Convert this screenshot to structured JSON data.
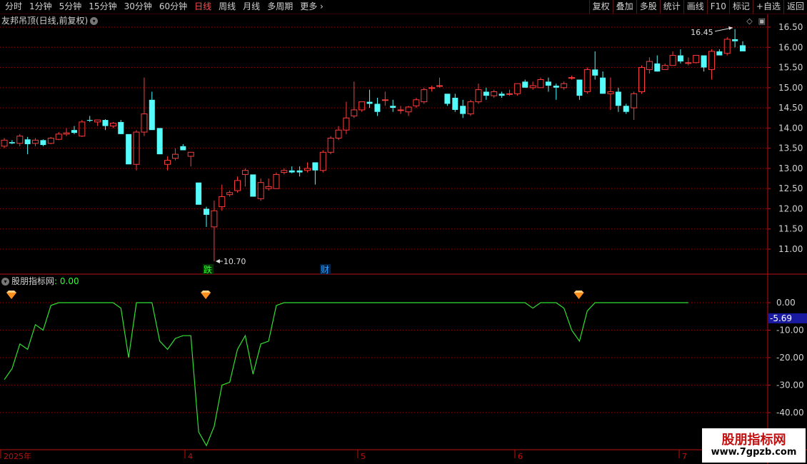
{
  "toolbar": {
    "periods": [
      "分时",
      "1分钟",
      "5分钟",
      "15分钟",
      "30分钟",
      "60分钟",
      "日线",
      "周线",
      "月线",
      "多周期",
      "更多"
    ],
    "active_period": "日线",
    "tools": [
      "复权",
      "叠加",
      "多股",
      "统计",
      "画线",
      "F10",
      "标记",
      "+自选",
      "返回"
    ]
  },
  "main_panel": {
    "title": "友邦吊顶(日线,前复权)",
    "high_label": "16.45",
    "low_label": "10.70",
    "event_marks": [
      "跌",
      "财"
    ]
  },
  "indicator_panel": {
    "name": "股朋指标网",
    "value_text": ": 0.00",
    "current_label": "-5.69"
  },
  "watermark": {
    "title": "股朋指标网",
    "url": "www.7gpzb.com"
  },
  "colors": {
    "up": "#ff3c3c",
    "down": "#54fcfc",
    "grid": "#a00000",
    "axis": "#c01010",
    "indicator_line": "#30e030",
    "signal_marker": "#ff9020"
  },
  "chart_data": [
    {
      "type": "candlestick",
      "title": "友邦吊顶(日线,前复权)",
      "ylim": [
        10.4,
        16.75
      ],
      "yticks": [
        11.0,
        11.5,
        12.0,
        12.5,
        13.0,
        13.5,
        14.0,
        14.5,
        15.0,
        15.5,
        16.0,
        16.5
      ],
      "x_labels": [
        "2025年",
        "4",
        "5",
        "6",
        "7"
      ],
      "annotations": [
        {
          "text": "16.45",
          "type": "high"
        },
        {
          "text": "10.70",
          "type": "low"
        }
      ],
      "ohlc": [
        [
          13.55,
          13.75,
          13.5,
          13.7
        ],
        [
          13.65,
          13.7,
          13.6,
          13.62
        ],
        [
          13.62,
          13.85,
          13.55,
          13.8
        ],
        [
          13.72,
          13.78,
          13.35,
          13.6
        ],
        [
          13.62,
          13.75,
          13.55,
          13.7
        ],
        [
          13.7,
          13.72,
          13.55,
          13.58
        ],
        [
          13.62,
          13.78,
          13.6,
          13.75
        ],
        [
          13.72,
          13.9,
          13.7,
          13.85
        ],
        [
          13.85,
          14.0,
          13.8,
          13.88
        ],
        [
          13.95,
          14.05,
          13.85,
          13.88
        ],
        [
          13.8,
          14.2,
          13.78,
          14.15
        ],
        [
          14.2,
          14.3,
          14.15,
          14.18
        ],
        [
          14.15,
          14.2,
          14.05,
          14.2
        ],
        [
          14.2,
          14.22,
          13.95,
          14.05
        ],
        [
          14.05,
          14.15,
          14.0,
          14.12
        ],
        [
          14.15,
          14.2,
          13.9,
          13.85
        ],
        [
          13.85,
          13.85,
          13.1,
          13.1
        ],
        [
          13.1,
          13.95,
          12.95,
          13.9
        ],
        [
          13.9,
          15.25,
          13.8,
          14.35
        ],
        [
          14.7,
          14.9,
          13.95,
          13.95
        ],
        [
          14.0,
          14.0,
          13.35,
          13.35
        ],
        [
          13.1,
          13.3,
          12.95,
          13.2
        ],
        [
          13.25,
          13.5,
          13.2,
          13.35
        ],
        [
          13.55,
          13.6,
          13.45,
          13.45
        ],
        [
          13.3,
          13.4,
          13.05,
          13.4
        ],
        [
          12.65,
          12.65,
          12.1,
          12.1
        ],
        [
          12.0,
          12.05,
          11.55,
          11.85
        ],
        [
          11.55,
          12.2,
          10.7,
          11.95
        ],
        [
          12.05,
          12.6,
          11.95,
          12.3
        ],
        [
          12.35,
          12.45,
          12.3,
          12.4
        ],
        [
          12.45,
          12.8,
          12.4,
          12.7
        ],
        [
          12.85,
          13.0,
          12.55,
          12.95
        ],
        [
          12.85,
          12.85,
          12.3,
          12.3
        ],
        [
          12.25,
          12.75,
          12.2,
          12.65
        ],
        [
          12.5,
          12.75,
          12.45,
          12.55
        ],
        [
          12.5,
          12.9,
          12.5,
          12.85
        ],
        [
          12.9,
          13.0,
          12.85,
          12.95
        ],
        [
          12.95,
          13.05,
          12.88,
          12.9
        ],
        [
          12.95,
          13.05,
          12.8,
          12.9
        ],
        [
          12.95,
          13.15,
          12.9,
          13.0
        ],
        [
          13.15,
          13.15,
          12.6,
          12.95
        ],
        [
          12.95,
          13.45,
          12.9,
          13.4
        ],
        [
          13.4,
          13.8,
          13.35,
          13.75
        ],
        [
          13.75,
          14.05,
          13.7,
          13.95
        ],
        [
          13.95,
          14.65,
          13.85,
          14.25
        ],
        [
          14.3,
          15.15,
          14.25,
          14.45
        ],
        [
          14.45,
          14.65,
          14.4,
          14.65
        ],
        [
          14.65,
          14.95,
          14.5,
          14.6
        ],
        [
          14.6,
          14.75,
          14.3,
          14.4
        ],
        [
          14.7,
          14.9,
          14.55,
          14.7
        ],
        [
          14.55,
          14.7,
          14.4,
          14.5
        ],
        [
          14.45,
          14.55,
          14.35,
          14.45
        ],
        [
          14.4,
          14.55,
          14.3,
          14.52
        ],
        [
          14.55,
          14.75,
          14.5,
          14.7
        ],
        [
          14.65,
          15.0,
          14.6,
          14.95
        ],
        [
          15.0,
          15.05,
          14.9,
          15.0
        ],
        [
          15.05,
          15.25,
          15.0,
          15.05
        ],
        [
          14.85,
          14.85,
          14.55,
          14.6
        ],
        [
          14.75,
          14.85,
          14.4,
          14.45
        ],
        [
          14.55,
          14.7,
          14.25,
          14.35
        ],
        [
          14.35,
          14.7,
          14.3,
          14.65
        ],
        [
          14.65,
          15.1,
          14.6,
          14.95
        ],
        [
          14.9,
          15.0,
          14.7,
          14.8
        ],
        [
          14.8,
          14.95,
          14.75,
          14.9
        ],
        [
          14.85,
          14.9,
          14.75,
          14.8
        ],
        [
          14.85,
          14.95,
          14.8,
          14.85
        ],
        [
          14.85,
          15.1,
          14.8,
          15.1
        ],
        [
          15.15,
          15.2,
          15.0,
          15.0
        ],
        [
          15.0,
          15.15,
          14.95,
          15.05
        ],
        [
          15.0,
          15.25,
          15.0,
          15.2
        ],
        [
          15.15,
          15.25,
          14.9,
          15.05
        ],
        [
          15.05,
          15.1,
          14.7,
          15.0
        ],
        [
          15.0,
          15.15,
          14.95,
          15.1
        ],
        [
          15.25,
          15.3,
          15.2,
          15.25
        ],
        [
          15.2,
          15.2,
          14.7,
          14.8
        ],
        [
          14.9,
          15.5,
          14.85,
          15.45
        ],
        [
          15.45,
          15.9,
          15.2,
          15.3
        ],
        [
          15.25,
          15.4,
          14.9,
          14.85
        ],
        [
          14.85,
          15.25,
          14.45,
          14.9
        ],
        [
          14.9,
          15.0,
          14.4,
          14.55
        ],
        [
          14.55,
          14.6,
          14.35,
          14.4
        ],
        [
          14.5,
          14.9,
          14.2,
          14.85
        ],
        [
          14.9,
          15.55,
          14.85,
          15.5
        ],
        [
          15.45,
          15.75,
          15.35,
          15.65
        ],
        [
          15.6,
          15.8,
          15.45,
          15.4
        ],
        [
          15.45,
          15.6,
          15.45,
          15.55
        ],
        [
          15.55,
          15.9,
          15.55,
          15.8
        ],
        [
          15.8,
          15.95,
          15.6,
          15.65
        ],
        [
          15.6,
          15.75,
          15.55,
          15.62
        ],
        [
          15.62,
          15.8,
          15.6,
          15.8
        ],
        [
          15.8,
          15.8,
          15.4,
          15.5
        ],
        [
          15.45,
          15.95,
          15.2,
          15.9
        ],
        [
          15.9,
          15.95,
          15.8,
          15.8
        ],
        [
          15.85,
          16.25,
          15.8,
          16.2
        ],
        [
          16.2,
          16.45,
          16.0,
          16.15
        ],
        [
          16.05,
          16.15,
          15.9,
          15.9
        ]
      ]
    },
    {
      "type": "line",
      "name": "股朋指标网",
      "ylim": [
        -46,
        4
      ],
      "yticks": [
        0.0,
        -10.0,
        -20.0,
        -30.0,
        -40.0
      ],
      "series": [
        {
          "values": [
            -28,
            -24,
            -15,
            -17,
            -8,
            -10,
            -1,
            0,
            0,
            0,
            0,
            0,
            0,
            0,
            0,
            -2,
            -20,
            0,
            0,
            0,
            -14,
            -17,
            -13,
            -12,
            -12,
            -47,
            -52,
            -45,
            -30,
            -29,
            -17,
            -12,
            -26,
            -15,
            -14,
            -1,
            0,
            0,
            0,
            0,
            0,
            0,
            0,
            0,
            0,
            0,
            0,
            0,
            0,
            0,
            0,
            0,
            0,
            0,
            0,
            0,
            0,
            0,
            0,
            0,
            0,
            0,
            0,
            0,
            0,
            0,
            0,
            0,
            -2,
            0,
            0,
            0,
            -2,
            -10,
            -14,
            -3,
            0,
            0,
            0,
            0,
            0,
            0,
            0,
            0,
            0,
            0,
            0,
            0,
            0
          ]
        }
      ],
      "signals": [
        0,
        25,
        73
      ]
    }
  ]
}
